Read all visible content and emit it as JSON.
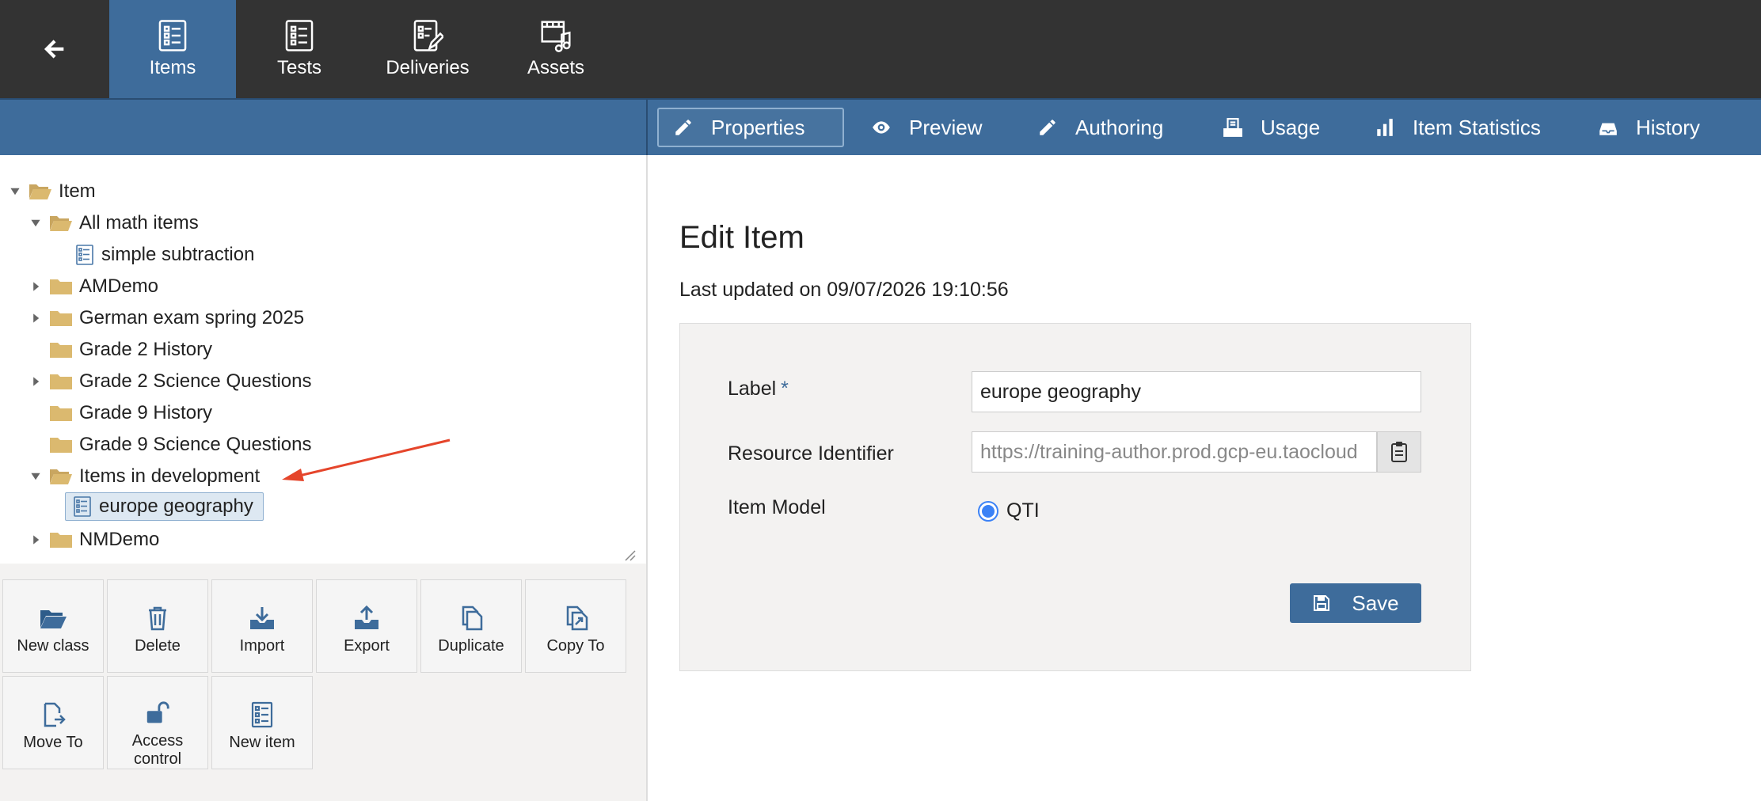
{
  "nav": {
    "back_icon": "arrow-left-icon",
    "tabs": [
      {
        "label": "Items",
        "icon": "items-list-icon",
        "active": true
      },
      {
        "label": "Tests",
        "icon": "tests-icon",
        "active": false
      },
      {
        "label": "Deliveries",
        "icon": "deliveries-icon",
        "active": false
      },
      {
        "label": "Assets",
        "icon": "assets-media-icon",
        "active": false
      }
    ]
  },
  "actions": {
    "tabs": [
      {
        "label": "Properties",
        "icon": "pencil-icon",
        "active": true
      },
      {
        "label": "Preview",
        "icon": "eye-icon",
        "active": false
      },
      {
        "label": "Authoring",
        "icon": "pencil-icon",
        "active": false
      },
      {
        "label": "Usage",
        "icon": "usage-icon",
        "active": false
      },
      {
        "label": "Item Statistics",
        "icon": "bar-chart-icon",
        "active": false
      },
      {
        "label": "History",
        "icon": "history-icon",
        "active": false
      }
    ]
  },
  "tree": {
    "items": [
      {
        "label": "Item",
        "type": "folder",
        "expanded": true
      },
      {
        "label": "All math items",
        "type": "folder",
        "expanded": true
      },
      {
        "label": "simple subtraction",
        "type": "item"
      },
      {
        "label": "AMDemo",
        "type": "folder",
        "expanded": false
      },
      {
        "label": "German exam spring 2025",
        "type": "folder",
        "expanded": false
      },
      {
        "label": "Grade 2 History",
        "type": "folder"
      },
      {
        "label": "Grade 2 Science Questions",
        "type": "folder",
        "expanded": false
      },
      {
        "label": "Grade 9 History",
        "type": "folder"
      },
      {
        "label": "Grade 9 Science Questions",
        "type": "folder"
      },
      {
        "label": "Items in development",
        "type": "folder",
        "expanded": true
      },
      {
        "label": "europe geography",
        "type": "item",
        "selected": true
      },
      {
        "label": "NMDemo",
        "type": "folder",
        "expanded": false
      }
    ]
  },
  "toolbar": {
    "buttons": [
      {
        "label": "New class",
        "icon": "folder-open-icon"
      },
      {
        "label": "Delete",
        "icon": "trash-icon"
      },
      {
        "label": "Import",
        "icon": "import-icon"
      },
      {
        "label": "Export",
        "icon": "export-icon"
      },
      {
        "label": "Duplicate",
        "icon": "duplicate-icon"
      },
      {
        "label": "Copy To",
        "icon": "copy-to-icon"
      },
      {
        "label": "Move To",
        "icon": "move-to-icon"
      },
      {
        "label": "Access control",
        "icon": "unlock-icon"
      },
      {
        "label": "New item",
        "icon": "new-item-icon"
      }
    ]
  },
  "main": {
    "title": "Edit Item",
    "last_updated": "Last updated on 09/07/2026 19:10:56",
    "form": {
      "label_label": "Label",
      "required_mark": "*",
      "label_value": "europe geography",
      "resource_label": "Resource Identifier",
      "resource_value": "https://training-author.prod.gcp-eu.taocloud",
      "model_label": "Item Model",
      "model_value": "QTI",
      "save_label": "Save"
    }
  },
  "colors": {
    "topbar": "#333333",
    "accent": "#3e6c9b",
    "panel_bg": "#f3f2f1",
    "radio": "#3b82f6",
    "annotation_arrow": "#e5452b"
  }
}
